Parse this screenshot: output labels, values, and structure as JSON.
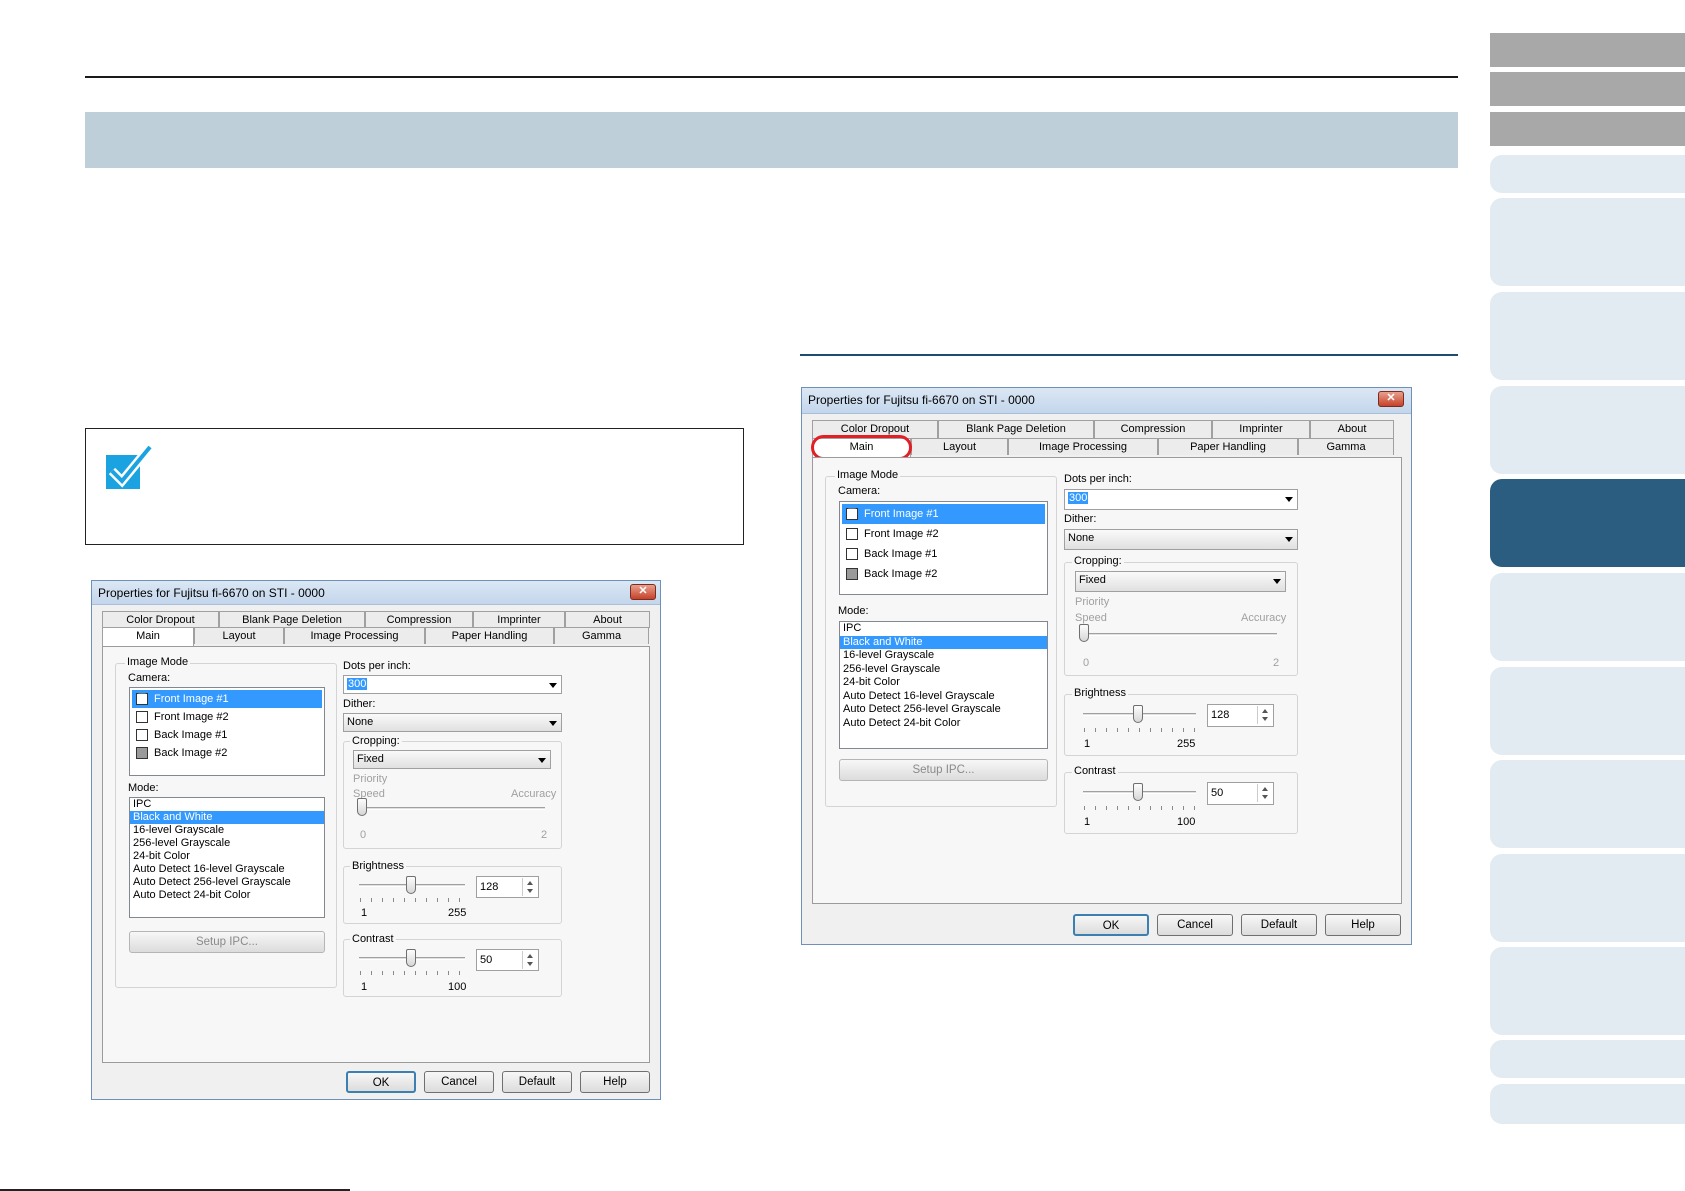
{
  "dialog": {
    "title": "Properties for Fujitsu fi-6670 on STI - 0000",
    "close_glyph": "✕",
    "tabs_row1": [
      "Color Dropout",
      "Blank Page Deletion",
      "Compression",
      "Imprinter",
      "About"
    ],
    "tabs_row2": [
      "Main",
      "Layout",
      "Image Processing",
      "Paper Handling",
      "Gamma"
    ],
    "image_mode_label": "Image Mode",
    "camera_label": "Camera:",
    "camera_items": [
      {
        "label": "Front Image #1",
        "checked": "☑",
        "selected": true
      },
      {
        "label": "Front Image #2",
        "checked": "",
        "selected": false
      },
      {
        "label": "Back Image #1",
        "checked": "",
        "selected": false
      },
      {
        "label": "Back Image #2",
        "checked": "",
        "selected": false
      }
    ],
    "mode_label": "Mode:",
    "mode_items": [
      "IPC",
      "Black and White",
      "16-level Grayscale",
      "256-level Grayscale",
      "24-bit Color",
      "Auto Detect 16-level Grayscale",
      "Auto Detect 256-level Grayscale",
      "Auto Detect 24-bit Color"
    ],
    "mode_selected_index": 1,
    "setup_ipc_label": "Setup IPC...",
    "dpi_label": "Dots per inch:",
    "dpi_value": "300",
    "dither_label": "Dither:",
    "dither_value": "None",
    "cropping_label": "Cropping:",
    "cropping_value": "Fixed",
    "priority_label": "Priority",
    "speed_label": "Speed",
    "accuracy_label": "Accuracy",
    "priority_min": "0",
    "priority_max": "2",
    "brightness_label": "Brightness",
    "brightness_value": "128",
    "brightness_min": "1",
    "brightness_max": "255",
    "brightness_level": 0.5,
    "contrast_label": "Contrast",
    "contrast_value": "50",
    "contrast_min": "1",
    "contrast_max": "100",
    "contrast_level": 0.5,
    "buttons": {
      "ok": "OK",
      "cancel": "Cancel",
      "default": "Default",
      "help": "Help"
    }
  },
  "colors": {
    "header_band": "#bfcfd9",
    "side_tab_gray": "#a8a8a8",
    "side_tab_light": "#e2ebf1",
    "side_tab_active": "#2a5d80",
    "highlight_ring": "#e01f26",
    "check_icon": "#1aa3e0"
  }
}
